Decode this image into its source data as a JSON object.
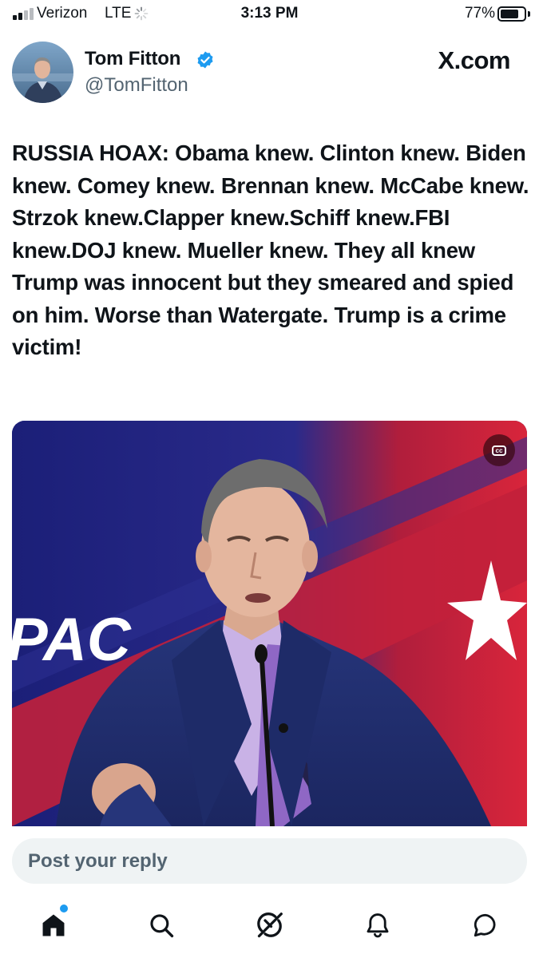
{
  "status_bar": {
    "carrier": "Verizon",
    "network": "LTE",
    "time": "3:13 PM",
    "battery": "77%",
    "battery_level": 0.77
  },
  "post": {
    "author_name": "Tom Fitton",
    "handle": "@TomFitton",
    "site": "X.com",
    "verified": true,
    "text": "RUSSIA HOAX: Obama knew. Clinton knew. Biden knew. Comey knew. Brennan knew. McCabe knew. Strzok knew.Clapper knew.Schiff knew.FBI knew.DOJ knew. Mueller knew. They all knew Trump was innocent but they smeared and spied on him. Worse than Watergate. Trump is a crime victim!",
    "media": {
      "type": "video",
      "backdrop_text": "PAC",
      "captions_icon": "closed-captions-icon",
      "backdrop_colors": {
        "blue": "#1e2277",
        "red": "#c8203a",
        "white": "#ffffff"
      }
    }
  },
  "reply": {
    "placeholder": "Post your reply"
  },
  "tab_bar": {
    "tabs": [
      {
        "name": "home",
        "icon": "home-icon",
        "active": true,
        "has_notification": true
      },
      {
        "name": "search",
        "icon": "search-icon"
      },
      {
        "name": "grok",
        "icon": "grok-icon"
      },
      {
        "name": "notifications",
        "icon": "bell-icon"
      },
      {
        "name": "messages",
        "icon": "chat-bubble-icon"
      }
    ]
  },
  "colors": {
    "text": "#0f1419",
    "secondary": "#536471",
    "accent": "#1d9bf0",
    "input_bg": "#eff3f4"
  }
}
